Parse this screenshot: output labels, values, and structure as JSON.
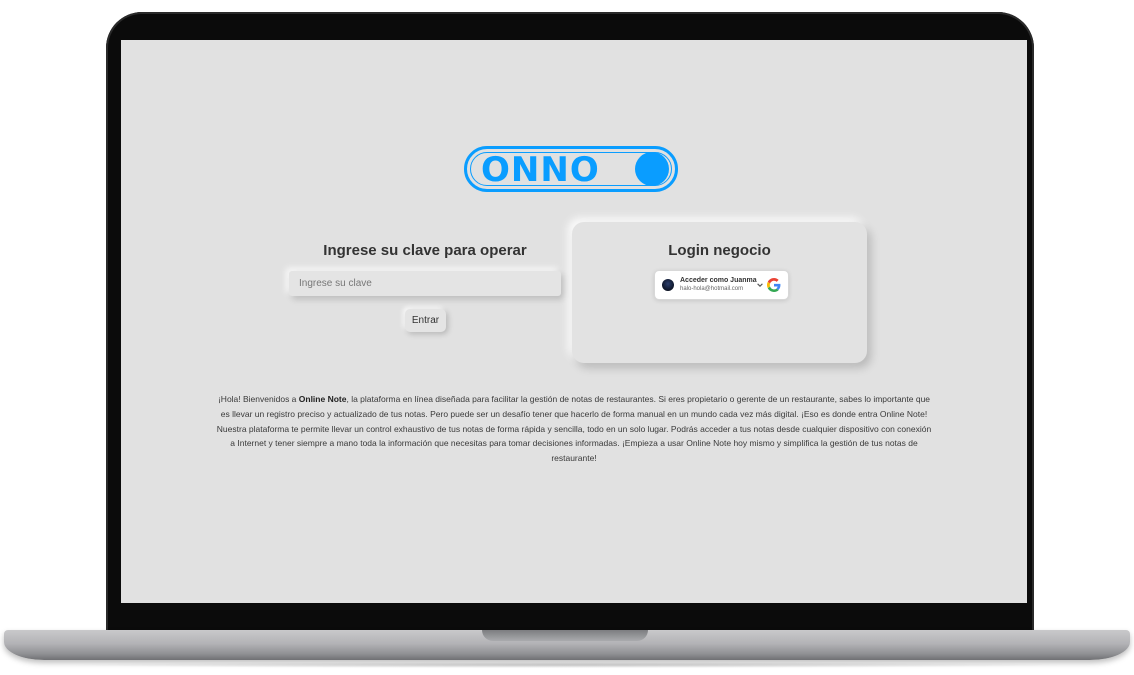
{
  "logo": {
    "text": "ONNO"
  },
  "pin_panel": {
    "title": "Ingrese su clave para operar",
    "input_placeholder": "Ingrese su clave",
    "input_value": "",
    "submit_label": "Entrar"
  },
  "business_login": {
    "title": "Login negocio",
    "google_button": {
      "account_label": "Acceder como Juanma",
      "email": "halo-hola@hotmail.com",
      "icon": "google-icon"
    }
  },
  "description": {
    "prefix": "¡Hola! Bienvenidos a ",
    "brand": "Online Note",
    "body": ", la plataforma en línea diseñada para facilitar la gestión de notas de restaurantes. Si eres propietario o gerente de un restaurante, sabes lo importante que es llevar un registro preciso y actualizado de tus notas. Pero puede ser un desafío tener que hacerlo de forma manual en un mundo cada vez más digital. ¡Eso es donde entra Online Note! Nuestra plataforma te permite llevar un control exhaustivo de tus notas de forma rápida y sencilla, todo en un solo lugar. Podrás acceder a tus notas desde cualquier dispositivo con conexión a Internet y tener siempre a mano toda la información que necesitas para tomar decisiones informadas. ¡Empieza a usar Online Note hoy mismo y simplifica la gestión de tus notas de restaurante!"
  },
  "colors": {
    "accent": "#0a9dff",
    "background": "#e1e1e1",
    "text": "#333333"
  }
}
